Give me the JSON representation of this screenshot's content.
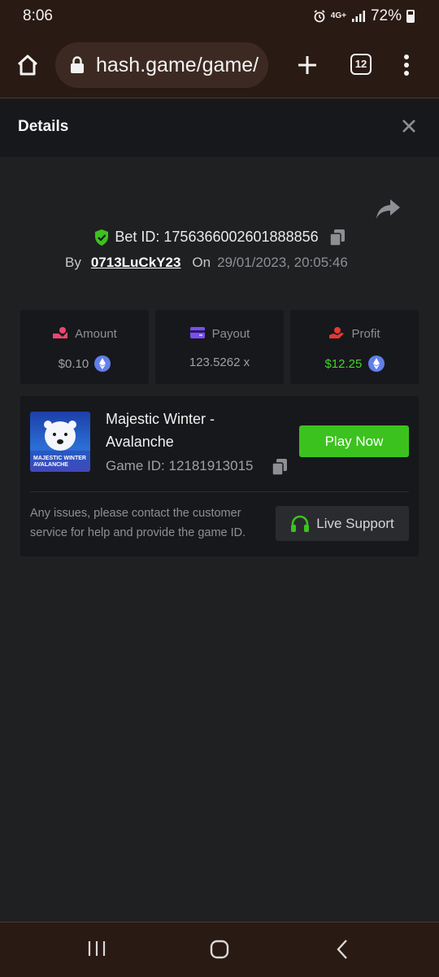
{
  "status_bar": {
    "time": "8:06",
    "network": "4G+",
    "battery": "72%"
  },
  "browser": {
    "url": "hash.game/game/",
    "tab_count": "12",
    "icons": [
      "home-icon",
      "lock-icon",
      "plus-icon",
      "tabs-icon",
      "more-vert-icon"
    ]
  },
  "header": {
    "title": "Details",
    "close_icon": "close-icon"
  },
  "bet": {
    "id_label": "Bet ID:",
    "id_value": "1756366002601888856",
    "by_label": "By",
    "user": "0713LuCkY23",
    "on_label": "On",
    "datetime": "29/01/2023, 20:05:46"
  },
  "stats": {
    "amount": {
      "label": "Amount",
      "value": "$0.10"
    },
    "payout": {
      "label": "Payout",
      "value": "123.5262 x"
    },
    "profit": {
      "label": "Profit",
      "value": "$12.25"
    }
  },
  "game": {
    "title": "Majestic Winter - Avalanche",
    "thumb_line1": "MAJESTIC WINTER",
    "thumb_line2": "AVALANCHE",
    "id_label": "Game ID:",
    "id_value": "12181913015",
    "play_label": "Play Now",
    "help_text": "Any issues, please contact the customer service for help and provide the game ID.",
    "support_label": "Live Support"
  },
  "colors": {
    "accent_green": "#3cc21f",
    "profit_green": "#41d42b",
    "eth_blue": "#627eea",
    "payout_purple": "#7b4ef0",
    "amount_pink": "#e8476f",
    "profit_red": "#e53935"
  }
}
